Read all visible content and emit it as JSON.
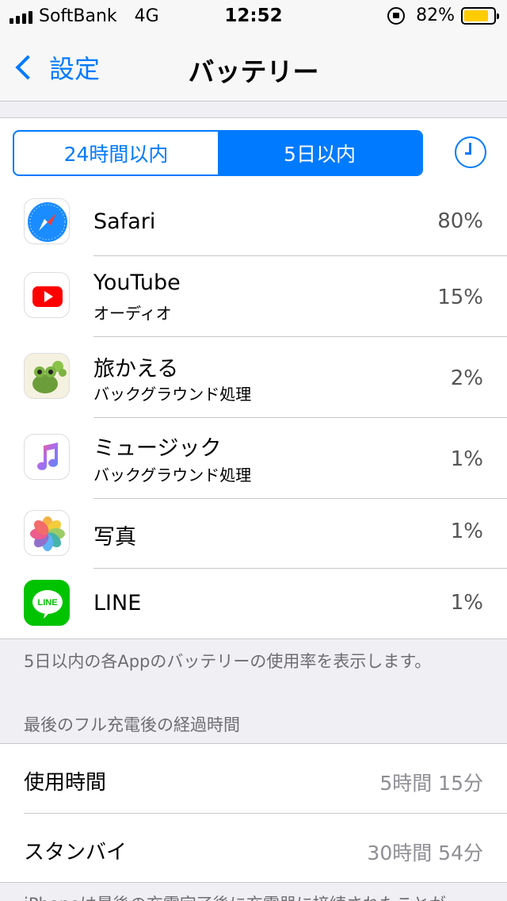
{
  "status_bar": {
    "carrier": "SoftBank",
    "network": "4G",
    "time": "12:52",
    "battery_percent": "82%",
    "battery_level": 0.82,
    "battery_color": "#ffcc00"
  },
  "nav": {
    "back_label": "設定",
    "title": "バッテリー"
  },
  "segments": {
    "options": [
      "24時間以内",
      "5日以内"
    ],
    "selected": "5日以内"
  },
  "apps": [
    {
      "name": "Safari",
      "sub": "",
      "percent": "80%",
      "icon": "safari-icon"
    },
    {
      "name": "YouTube",
      "sub": "オーディオ",
      "percent": "15%",
      "icon": "youtube-icon"
    },
    {
      "name": "旅かえる",
      "sub": "バックグラウンド処理",
      "percent": "2%",
      "icon": "tabikaeru-icon"
    },
    {
      "name": "ミュージック",
      "sub": "バックグラウンド処理",
      "percent": "1%",
      "icon": "music-icon"
    },
    {
      "name": "写真",
      "sub": "",
      "percent": "1%",
      "icon": "photos-icon"
    },
    {
      "name": "LINE",
      "sub": "",
      "percent": "1%",
      "icon": "line-icon"
    }
  ],
  "footer_note": "5日以内の各Appのバッテリーの使用率を表示します。",
  "section_header": "最後のフル充電後の経過時間",
  "stats": [
    {
      "label": "使用時間",
      "value": "5時間 15分"
    },
    {
      "label": "スタンバイ",
      "value": "30時間 54分"
    }
  ],
  "bottom_note": "iPhoneは最後の充電完了後に充電器に接続されたことが",
  "colors": {
    "accent": "#007aff",
    "line_green": "#00c300",
    "youtube_red": "#ff0000"
  }
}
